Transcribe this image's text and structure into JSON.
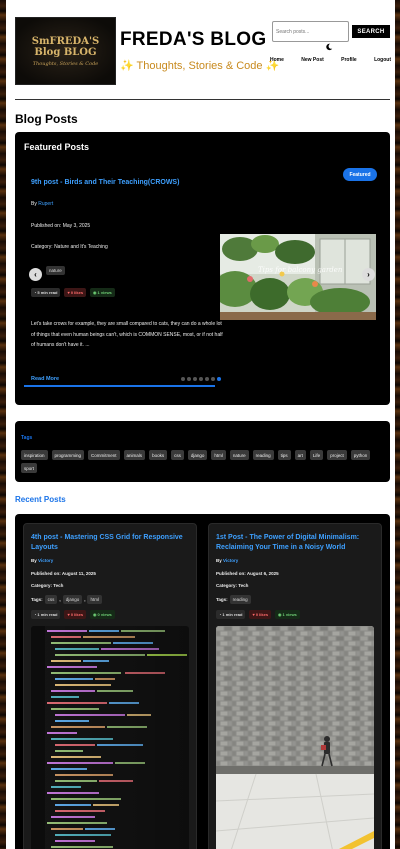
{
  "header": {
    "logo": {
      "line1": "SmFREDA'S",
      "line2": "Blog BLOG",
      "line3": "Thoughts, Stories & Code"
    },
    "site_title": "FREDA'S BLOG",
    "tagline": "✨ Thoughts, Stories & Code ✨",
    "search": {
      "placeholder": "Search posts...",
      "button": "SEARCH"
    },
    "theme_toggle_icon": "moon-icon",
    "nav": [
      "Home",
      "New Post",
      "Profile",
      "Logout"
    ]
  },
  "section_heading": "Blog Posts",
  "featured": {
    "heading": "Featured Posts",
    "badge": "Featured",
    "title": "9th post - Birds and Their Teaching(CROWS)",
    "by_label": "By",
    "author": "Rupert",
    "published": "Published on: May 3, 2025",
    "category": "Category: Nature and It's Teaching",
    "tag": "nature",
    "stats": {
      "read": "5 min read",
      "likes": "0 likes",
      "views": "1 views"
    },
    "excerpt": "Let's take crows for example, they are small compared to cats, they can do a whole lot of things that even human beings can't, which is COMMON SENSE, most, or if not half of humans don't have it. ...",
    "read_more": "Read More",
    "image_caption": "Tips for balcony garden",
    "arrows": {
      "prev": "‹",
      "next": "›"
    },
    "slides_total": 7,
    "active_slide": 7
  },
  "tags": {
    "heading": "Tags",
    "items": [
      "inspiration",
      "programming",
      "Commitment",
      "animals",
      "books",
      "css",
      "django",
      "html",
      "nature",
      "reading",
      "tips",
      "art",
      "Life",
      "project",
      "python",
      "sport"
    ]
  },
  "recent": {
    "heading": "Recent Posts",
    "posts": [
      {
        "title": "4th post - Mastering CSS Grid for Responsive Layouts",
        "by_label": "By",
        "author": "Victory",
        "published": "Published on: August 11, 2025",
        "category": "Category: Tech",
        "tags_label": "Tags:",
        "tags": [
          "css",
          "django",
          "html"
        ],
        "stats": {
          "read": "1 min read",
          "likes": "0 likes",
          "views": "0 views"
        }
      },
      {
        "title": "1st Post - The Power of Digital Minimalism: Reclaiming Your Time in a Noisy World",
        "by_label": "By",
        "author": "Victory",
        "published": "Published on: August 6, 2025",
        "category": "Category: Tech",
        "tags_label": "Tags:",
        "tags": [
          "reading"
        ],
        "stats": {
          "read": "1 min read",
          "likes": "0 likes",
          "views": "1 views"
        }
      }
    ]
  },
  "colors": {
    "accent": "#1a73e8",
    "link": "#3ea0ff",
    "tagline": "#c88a1e",
    "panel_bg": "#000000",
    "card_bg": "#1a1a1a"
  }
}
